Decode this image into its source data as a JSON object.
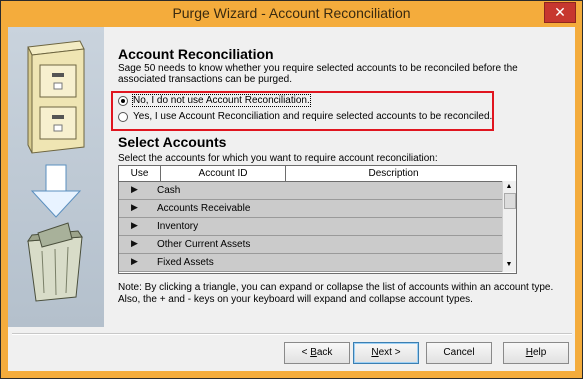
{
  "window": {
    "title": "Purge Wizard - Account Reconciliation",
    "close_glyph": "✕"
  },
  "section1": {
    "heading": "Account Reconciliation",
    "description": "Sage 50 needs to know whether you require selected accounts to be reconciled before the associated transactions can be purged.",
    "options": [
      {
        "label": "No, I do not use Account Reconciliation.",
        "selected": true
      },
      {
        "label": "Yes, I use Account Reconciliation and require selected accounts to be reconciled.",
        "selected": false
      }
    ]
  },
  "section2": {
    "heading": "Select Accounts",
    "instruction": "Select the accounts for which you want to require account reconciliation:",
    "columns": [
      "Use",
      "Account ID",
      "Description"
    ],
    "rows": [
      {
        "expander": "▶",
        "name": "Cash"
      },
      {
        "expander": "▶",
        "name": "Accounts Receivable"
      },
      {
        "expander": "▶",
        "name": "Inventory"
      },
      {
        "expander": "▶",
        "name": "Other Current Assets"
      },
      {
        "expander": "▶",
        "name": "Fixed Assets"
      }
    ],
    "scroll_up": "▲",
    "scroll_down": "▼"
  },
  "note": "Note: By clicking a triangle, you can expand or collapse the list of accounts within an account type. Also, the + and - keys on your keyboard will expand and collapse account types.",
  "buttons": {
    "back": {
      "prefix": "< ",
      "mnemonic": "B",
      "rest": "ack"
    },
    "next": {
      "mnemonic": "N",
      "rest": "ext >"
    },
    "cancel": "Cancel",
    "help": {
      "mnemonic": "H",
      "rest": "elp"
    }
  },
  "colors": {
    "title_bar": "#f4ac3c",
    "highlight_box": "#e0151f",
    "row_fill": "#cbcbcb"
  },
  "icons": [
    "filing-cabinet-icon",
    "down-arrow-icon",
    "trash-can-icon"
  ]
}
